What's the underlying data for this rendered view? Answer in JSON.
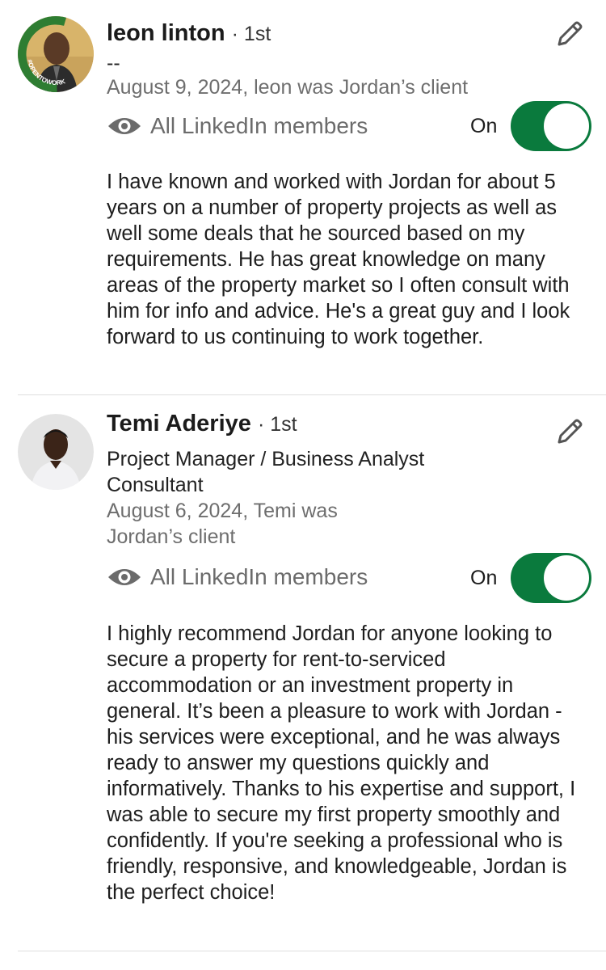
{
  "colors": {
    "toggle_on": "#0a7a3d",
    "secondary_text": "#6e6e6e",
    "open_to_work_ring": "#2e7d32"
  },
  "recommendations": [
    {
      "name": "leon linton",
      "degree": "· 1st",
      "headline": "--",
      "date": "August 9, 2024, leon was Jordan’s client",
      "badge": "#OPENTOWORK",
      "visibility": {
        "icon": "eye-icon",
        "label": "All LinkedIn members"
      },
      "toggle": {
        "label": "On",
        "state": "on"
      },
      "edit_icon": "pencil-icon",
      "text": "I have known and worked with Jordan for about 5 years on a number of property projects as well as well some deals that he sourced based on my requirements. He has great knowledge on many areas of the property market so I often consult with him for info and advice. He's a great guy and I look forward to us continuing to work together."
    },
    {
      "name": "Temi Aderiye",
      "degree": "· 1st",
      "headline": "Project Manager / Business Analyst Consultant",
      "date": "August 6, 2024, Temi was Jordan’s client",
      "visibility": {
        "icon": "eye-icon",
        "label": "All LinkedIn members"
      },
      "toggle": {
        "label": "On",
        "state": "on"
      },
      "edit_icon": "pencil-icon",
      "text": "I highly recommend Jordan for anyone looking to secure a property for rent-to-serviced accommodation or an investment property in general. It’s been a pleasure to work with Jordan - his services were exceptional, and he was always ready to answer my questions quickly and informatively. Thanks to his expertise and support, I was able to secure my first property smoothly and confidently. If you're seeking a professional who is friendly, responsive, and knowledgeable, Jordan is the perfect choice!"
    }
  ]
}
